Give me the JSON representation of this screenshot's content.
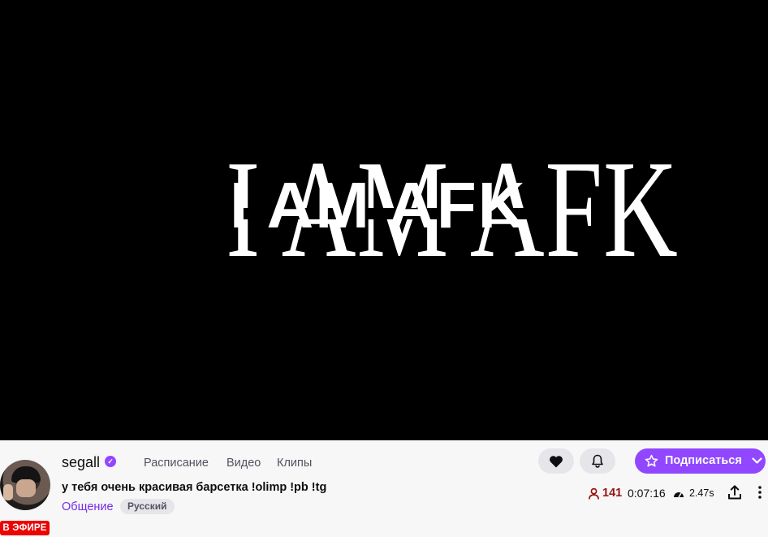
{
  "player": {
    "overlay_text": "I AM AFK"
  },
  "channel": {
    "name": "segall",
    "live_badge": "В ЭФИРЕ",
    "stream_title": "у тебя очень красивая барсетка !olimp !pb !tg",
    "category": "Общение",
    "tag": "Русский"
  },
  "nav": {
    "schedule": "Расписание",
    "videos": "Видео",
    "clips": "Клипы"
  },
  "actions": {
    "subscribe_label": "Подписаться"
  },
  "stats": {
    "viewers": "141",
    "uptime": "0:07:16",
    "latency": "2.47s"
  },
  "colors": {
    "accent": "#9147ff",
    "live": "#eb0400",
    "viewers": "#971311",
    "category": "#772ce8"
  },
  "icons": [
    "verified-icon",
    "heart-icon",
    "bell-icon",
    "star-icon",
    "chevron-down-icon",
    "viewers-icon",
    "latency-icon",
    "share-icon",
    "more-icon"
  ]
}
